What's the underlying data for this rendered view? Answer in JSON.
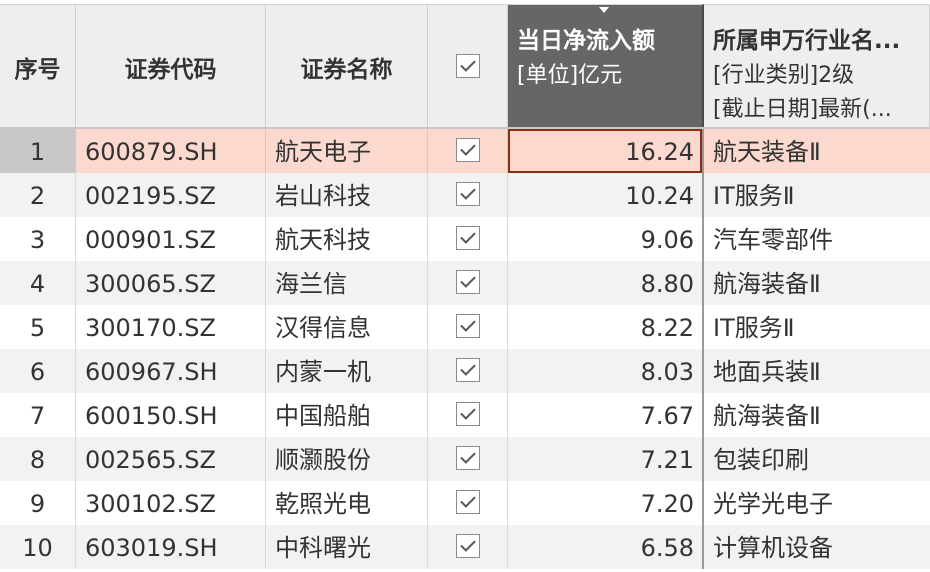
{
  "columns": {
    "index": "序号",
    "code": "证券代码",
    "name": "证券名称",
    "flow_title": "当日净流入额",
    "flow_unit": "[单位]亿元",
    "industry_title": "所属申万行业名...",
    "industry_type": "[行业类别]2级",
    "industry_date": "[截止日期]最新(..."
  },
  "rows": [
    {
      "index": "1",
      "code": "600879.SH",
      "name": "航天电子",
      "flow": "16.24",
      "industry": "航天装备Ⅱ"
    },
    {
      "index": "2",
      "code": "002195.SZ",
      "name": "岩山科技",
      "flow": "10.24",
      "industry": "IT服务Ⅱ"
    },
    {
      "index": "3",
      "code": "000901.SZ",
      "name": "航天科技",
      "flow": "9.06",
      "industry": "汽车零部件"
    },
    {
      "index": "4",
      "code": "300065.SZ",
      "name": "海兰信",
      "flow": "8.80",
      "industry": "航海装备Ⅱ"
    },
    {
      "index": "5",
      "code": "300170.SZ",
      "name": "汉得信息",
      "flow": "8.22",
      "industry": "IT服务Ⅱ"
    },
    {
      "index": "6",
      "code": "600967.SH",
      "name": "内蒙一机",
      "flow": "8.03",
      "industry": "地面兵装Ⅱ"
    },
    {
      "index": "7",
      "code": "600150.SH",
      "name": "中国船舶",
      "flow": "7.67",
      "industry": "航海装备Ⅱ"
    },
    {
      "index": "8",
      "code": "002565.SZ",
      "name": "顺灏股份",
      "flow": "7.21",
      "industry": "包装印刷"
    },
    {
      "index": "9",
      "code": "300102.SZ",
      "name": "乾照光电",
      "flow": "7.20",
      "industry": "光学光电子"
    },
    {
      "index": "10",
      "code": "603019.SH",
      "name": "中科曙光",
      "flow": "6.58",
      "industry": "计算机设备"
    }
  ],
  "state": {
    "selected_row": "1",
    "sorted_column": "当日净流入额",
    "sort_direction": "descending",
    "all_checked": true
  },
  "colors": {
    "selected_row_bg": "#fbd9cf",
    "sorted_header_bg": "#666666",
    "header_bg": "#eeeeee",
    "alt_row_bg": "#f2f2f2"
  }
}
